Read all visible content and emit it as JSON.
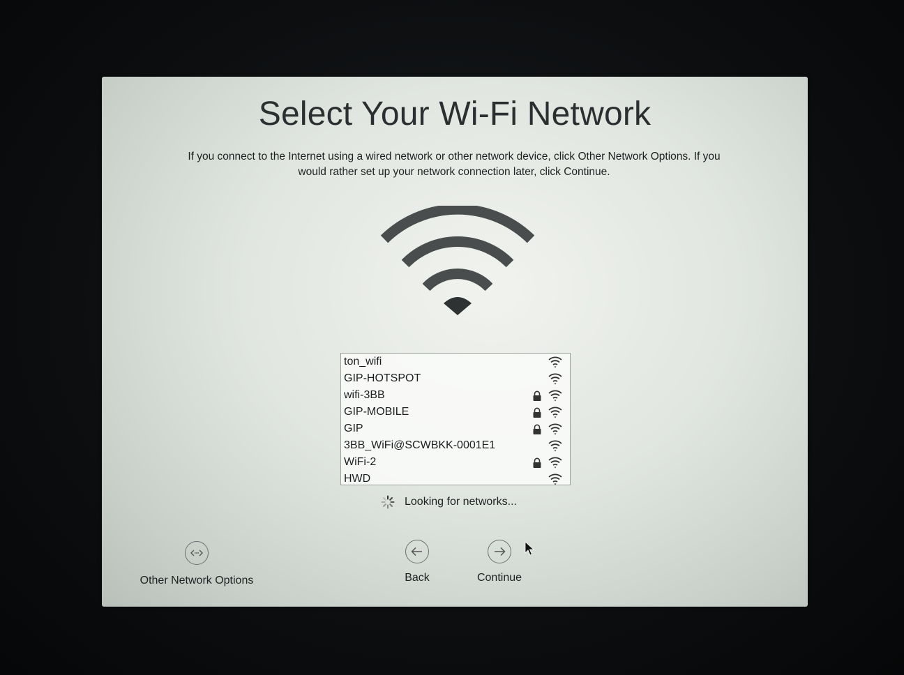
{
  "title": "Select Your Wi-Fi Network",
  "description": "If you connect to the Internet using a wired network or other network device, click Other Network Options. If you would rather set up your network connection later, click Continue.",
  "hero_icon": "wifi-icon",
  "networks": [
    {
      "name": "ton_wifi",
      "locked": false
    },
    {
      "name": "GIP-HOTSPOT",
      "locked": false
    },
    {
      "name": "wifi-3BB",
      "locked": true
    },
    {
      "name": "GIP-MOBILE",
      "locked": true
    },
    {
      "name": "GIP",
      "locked": true
    },
    {
      "name": "3BB_WiFi@SCWBKK-0001E1",
      "locked": false
    },
    {
      "name": "WiFi-2",
      "locked": true
    },
    {
      "name": "HWD",
      "locked": false
    }
  ],
  "status": {
    "text": "Looking for networks...",
    "icon": "spinner-icon"
  },
  "buttons": {
    "other_network_options": "Other Network Options",
    "back": "Back",
    "continue": "Continue"
  },
  "colors": {
    "accent": "#2c2f30",
    "background": "#e1e6e0"
  }
}
